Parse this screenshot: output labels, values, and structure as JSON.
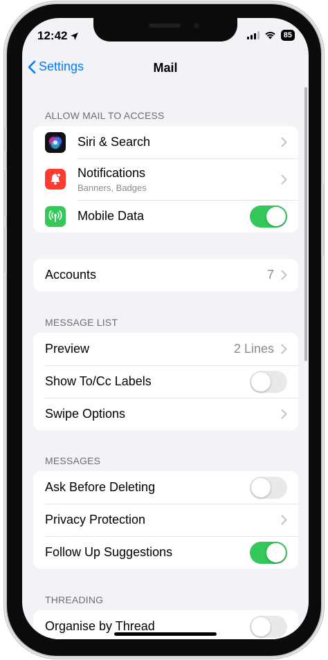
{
  "status_bar": {
    "time": "12:42",
    "battery": "85"
  },
  "nav": {
    "back_label": "Settings",
    "title": "Mail"
  },
  "sections": {
    "allow": {
      "header": "ALLOW MAIL TO ACCESS",
      "siri": {
        "label": "Siri & Search"
      },
      "notifications": {
        "label": "Notifications",
        "sub": "Banners, Badges"
      },
      "mobile_data": {
        "label": "Mobile Data",
        "enabled": true
      }
    },
    "accounts": {
      "label": "Accounts",
      "value": "7"
    },
    "message_list": {
      "header": "MESSAGE LIST",
      "preview": {
        "label": "Preview",
        "value": "2 Lines"
      },
      "show_tocc": {
        "label": "Show To/Cc Labels",
        "enabled": false
      },
      "swipe": {
        "label": "Swipe Options"
      }
    },
    "messages": {
      "header": "MESSAGES",
      "ask_delete": {
        "label": "Ask Before Deleting",
        "enabled": false
      },
      "privacy": {
        "label": "Privacy Protection"
      },
      "follow_up": {
        "label": "Follow Up Suggestions",
        "enabled": true
      }
    },
    "threading": {
      "header": "THREADING",
      "organise": {
        "label": "Organise by Thread",
        "enabled": false
      }
    }
  },
  "colors": {
    "accent": "#007aff",
    "toggle_on": "#34c759",
    "notifications_icon": "#ff3b30",
    "mobile_data_icon": "#34c759"
  }
}
